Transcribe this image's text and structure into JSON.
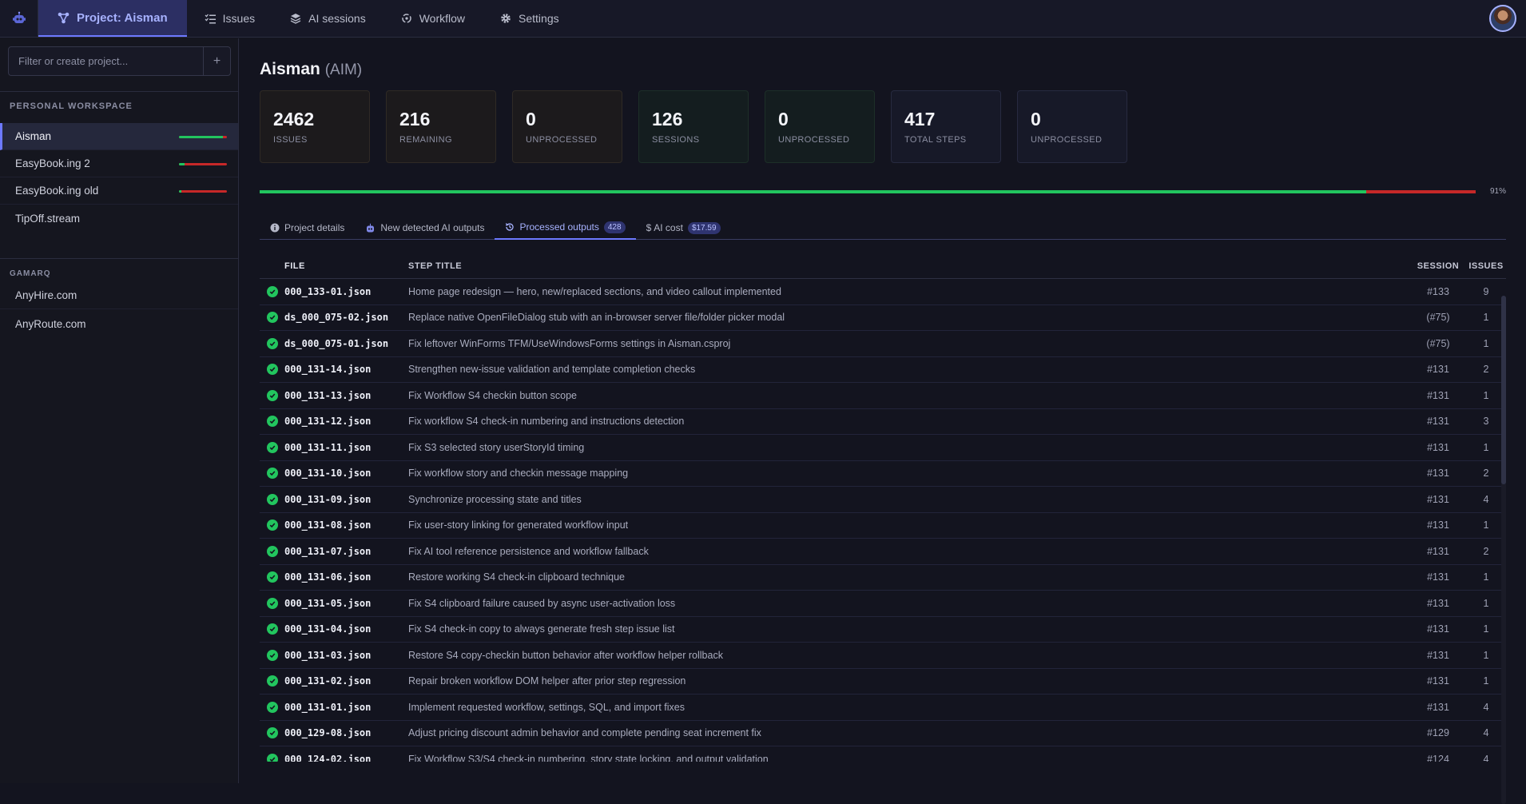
{
  "nav": {
    "project_label": "Project: Aisman",
    "issues_label": "Issues",
    "ai_sessions_label": "AI sessions",
    "workflow_label": "Workflow",
    "settings_label": "Settings"
  },
  "sidebar": {
    "filter_placeholder": "Filter or create project...",
    "add_label": "+",
    "personal_label": "PERSONAL WORKSPACE",
    "gamarq_label": "GAMARQ",
    "personal_projects": [
      {
        "name": "Aisman",
        "progress": 0.91
      },
      {
        "name": "EasyBook.ing 2",
        "progress": 0.12
      },
      {
        "name": "EasyBook.ing old",
        "progress": 0.05
      },
      {
        "name": "TipOff.stream"
      }
    ],
    "gamarq_projects": [
      {
        "name": "AnyHire.com"
      },
      {
        "name": "AnyRoute.com"
      }
    ]
  },
  "header": {
    "name": "Aisman",
    "code": "(AIM)"
  },
  "stats": [
    {
      "value": "2462",
      "label": "ISSUES"
    },
    {
      "value": "216",
      "label": "REMAINING"
    },
    {
      "value": "0",
      "label": "UNPROCESSED"
    },
    {
      "value": "126",
      "label": "SESSIONS"
    },
    {
      "value": "0",
      "label": "UNPROCESSED"
    },
    {
      "value": "417",
      "label": "TOTAL STEPS"
    },
    {
      "value": "0",
      "label": "UNPROCESSED"
    }
  ],
  "progress": {
    "value": 0.91,
    "label": "91%"
  },
  "tabs": {
    "project_details": "Project details",
    "new_detected": "New detected AI outputs",
    "processed": "Processed outputs",
    "processed_count": "428",
    "ai_cost": "AI cost",
    "ai_cost_value": "$17.59"
  },
  "table": {
    "headers": {
      "file": "FILE",
      "step_title": "STEP TITLE",
      "session": "SESSION",
      "issues": "ISSUES"
    },
    "rows": [
      {
        "file": "000_133-01.json",
        "title": "Home page redesign — hero, new/replaced sections, and video callout implemented",
        "session": "#133",
        "issues": "9"
      },
      {
        "file": "ds_000_075-02.json",
        "title": "Replace native OpenFileDialog stub with an in-browser server file/folder picker modal",
        "session": "(#75)",
        "issues": "1"
      },
      {
        "file": "ds_000_075-01.json",
        "title": "Fix leftover WinForms TFM/UseWindowsForms settings in Aisman.csproj",
        "session": "(#75)",
        "issues": "1"
      },
      {
        "file": "000_131-14.json",
        "title": "Strengthen new-issue validation and template completion checks",
        "session": "#131",
        "issues": "2"
      },
      {
        "file": "000_131-13.json",
        "title": "Fix Workflow S4 checkin button scope",
        "session": "#131",
        "issues": "1"
      },
      {
        "file": "000_131-12.json",
        "title": "Fix workflow S4 check-in numbering and instructions detection",
        "session": "#131",
        "issues": "3"
      },
      {
        "file": "000_131-11.json",
        "title": "Fix S3 selected story userStoryId timing",
        "session": "#131",
        "issues": "1"
      },
      {
        "file": "000_131-10.json",
        "title": "Fix workflow story and checkin message mapping",
        "session": "#131",
        "issues": "2"
      },
      {
        "file": "000_131-09.json",
        "title": "Synchronize processing state and titles",
        "session": "#131",
        "issues": "4"
      },
      {
        "file": "000_131-08.json",
        "title": "Fix user-story linking for generated workflow input",
        "session": "#131",
        "issues": "1"
      },
      {
        "file": "000_131-07.json",
        "title": "Fix AI tool reference persistence and workflow fallback",
        "session": "#131",
        "issues": "2"
      },
      {
        "file": "000_131-06.json",
        "title": "Restore working S4 check-in clipboard technique",
        "session": "#131",
        "issues": "1"
      },
      {
        "file": "000_131-05.json",
        "title": "Fix S4 clipboard failure caused by async user-activation loss",
        "session": "#131",
        "issues": "1"
      },
      {
        "file": "000_131-04.json",
        "title": "Fix S4 check-in copy to always generate fresh step issue list",
        "session": "#131",
        "issues": "1"
      },
      {
        "file": "000_131-03.json",
        "title": "Restore S4 copy-checkin button behavior after workflow helper rollback",
        "session": "#131",
        "issues": "1"
      },
      {
        "file": "000_131-02.json",
        "title": "Repair broken workflow DOM helper after prior step regression",
        "session": "#131",
        "issues": "1"
      },
      {
        "file": "000_131-01.json",
        "title": "Implement requested workflow, settings, SQL, and import fixes",
        "session": "#131",
        "issues": "4"
      },
      {
        "file": "000_129-08.json",
        "title": "Adjust pricing discount admin behavior and complete pending seat increment fix",
        "session": "#129",
        "issues": "4"
      },
      {
        "file": "000_124-02.json",
        "title": "Fix Workflow S3/S4 check-in numbering, story state locking, and output validation",
        "session": "#124",
        "issues": "4"
      }
    ]
  }
}
